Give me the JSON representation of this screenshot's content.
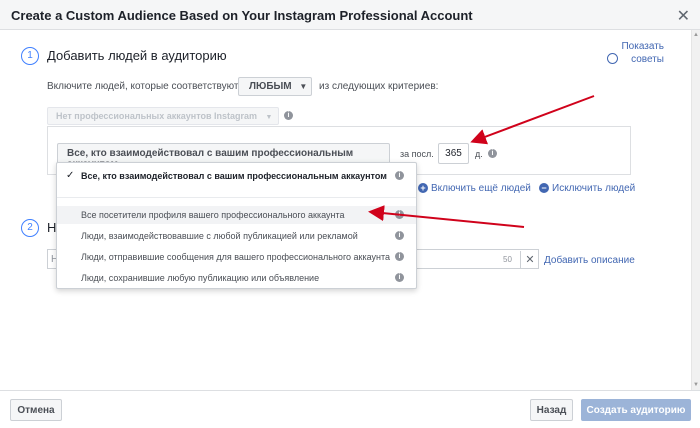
{
  "dialog": {
    "title": "Create a Custom Audience Based on Your Instagram Professional Account",
    "close": "✕"
  },
  "step1": {
    "number": "1",
    "title": "Добавить людей в аудиторию",
    "include_text": "Включите людей, которые соответствуют",
    "any_button": "ЛЮБЫМ",
    "criteria_text": "из следующих критериев:",
    "account_select": "Нет профессиональных аккаунтов Instagram",
    "engagement_select": "Все, кто взаимодействовал с вашим профессиональным аккаунтом",
    "last_label": "за посл.",
    "days_value": "365",
    "days_unit": "д.",
    "include_more": "Включить ещё людей",
    "exclude": "Исключить людей"
  },
  "tips": {
    "line1": "Показать",
    "line2": "советы"
  },
  "step2": {
    "number": "2",
    "title_partial": "Н",
    "name_placeholder": "Н",
    "char_count": "50",
    "add_description": "Добавить описание"
  },
  "dropdown": {
    "items": [
      {
        "label": "Все, кто взаимодействовал с вашим профессиональным аккаунтом",
        "selected": true
      },
      {
        "label": "Все посетители профиля вашего профессионального аккаунта",
        "selected": false
      },
      {
        "label": "Люди, взаимодействовавшие с любой публикацией или рекламой",
        "selected": false
      },
      {
        "label": "Люди, отправившие сообщения для вашего профессионального аккаунта",
        "selected": false
      },
      {
        "label": "Люди, сохранившие любую публикацию или объявление",
        "selected": false
      }
    ]
  },
  "footer": {
    "cancel": "Отмена",
    "back": "Назад",
    "create": "Создать аудиторию"
  },
  "colors": {
    "link": "#4267b2",
    "annotation_arrow": "#d0021b",
    "primary_disabled": "#9cb4d8"
  }
}
